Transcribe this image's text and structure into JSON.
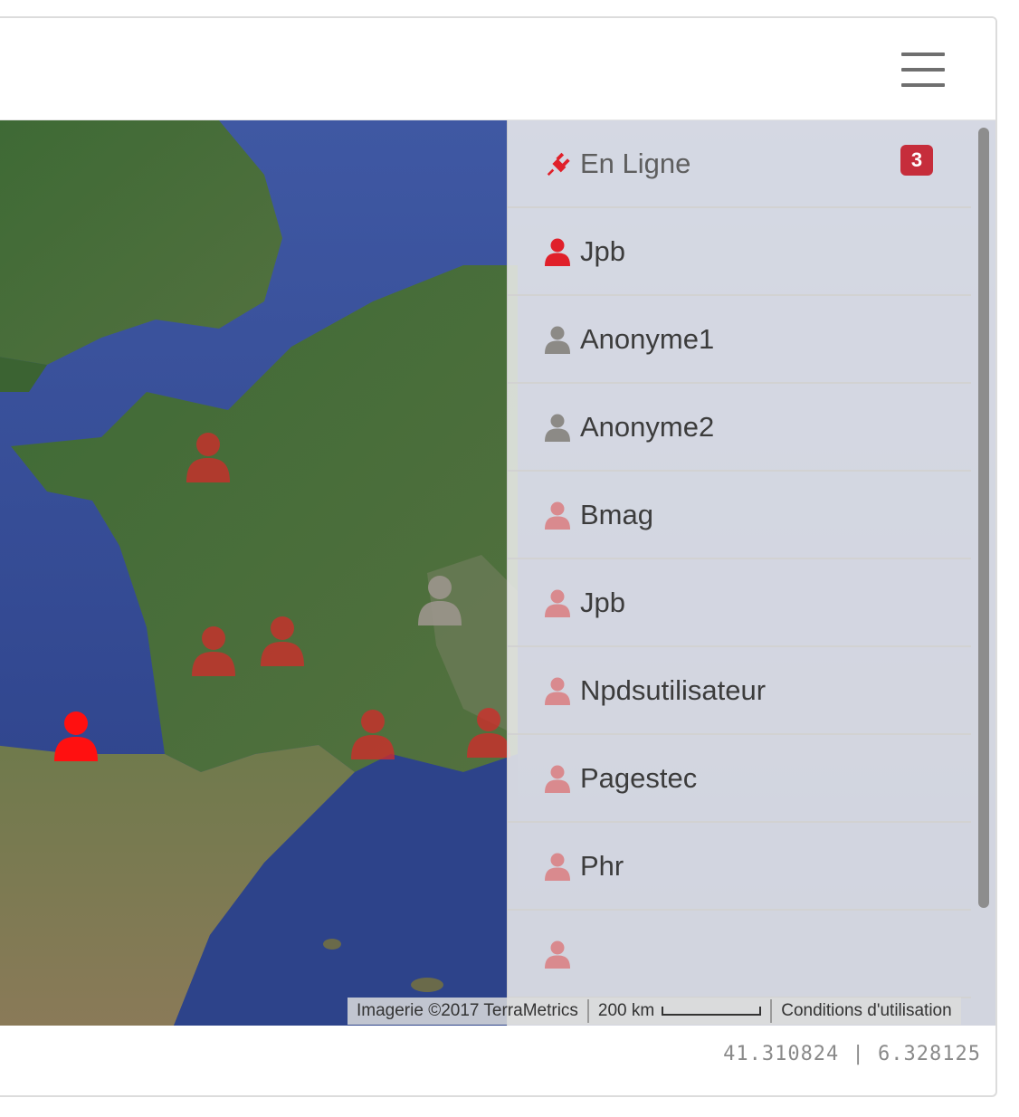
{
  "header": {
    "menu_icon": "hamburger-menu-icon"
  },
  "online_panel": {
    "title": "En Ligne",
    "title_icon": "plug-icon",
    "count": "3",
    "colors": {
      "online_user": "#e0202a",
      "anonymous_user": "#8c8a86",
      "offline_user": "#d98a8e",
      "badge": "#c62d3b"
    },
    "users": [
      {
        "name": "Jpb",
        "status": "online"
      },
      {
        "name": "Anonyme1",
        "status": "anonymous"
      },
      {
        "name": "Anonyme2",
        "status": "anonymous"
      },
      {
        "name": "Bmag",
        "status": "offline"
      },
      {
        "name": "Jpb",
        "status": "offline"
      },
      {
        "name": "Npdsutilisateur",
        "status": "offline"
      },
      {
        "name": "Pagestec",
        "status": "offline"
      },
      {
        "name": "Phr",
        "status": "offline"
      },
      {
        "name": "",
        "status": "offline"
      }
    ]
  },
  "map": {
    "attribution": "Imagerie ©2017 TerraMetrics",
    "scale": "200 km",
    "terms": "Conditions d'utilisation",
    "marker_icon": "user-icon"
  },
  "footer": {
    "coordinates": "41.310824  |  6.328125"
  }
}
